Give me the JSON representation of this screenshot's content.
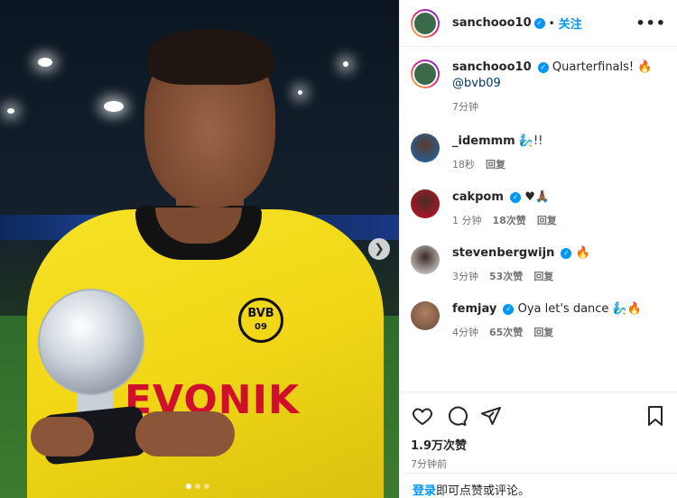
{
  "photo": {
    "sponsor_text": "EVONIK",
    "badge_text": "BVB",
    "badge_sub": "09"
  },
  "header": {
    "username": "sanchooo10",
    "separator": "•",
    "follow_label": "关注",
    "more_label": "•••"
  },
  "caption": {
    "username": "sanchooo10",
    "text": "Quarterfinals! 🔥",
    "mention": "@bvb09",
    "time": "7分钟"
  },
  "comments": [
    {
      "username": "_idemmm",
      "verified": false,
      "text": "🧞‍♂️!!",
      "time": "18秒",
      "likes": "",
      "reply": "回复"
    },
    {
      "username": "cakpom",
      "verified": true,
      "text": "♥🙏🏾",
      "time": "1 分钟",
      "likes": "18次赞",
      "reply": "回复"
    },
    {
      "username": "stevenbergwijn",
      "verified": true,
      "text": "🔥",
      "time": "3分钟",
      "likes": "53次赞",
      "reply": "回复"
    },
    {
      "username": "femjay",
      "verified": true,
      "text": "Oya let's dance 🧞‍♂️🔥",
      "time": "4分钟",
      "likes": "65次赞",
      "reply": "回复"
    }
  ],
  "footer": {
    "likes": "1.9万次赞",
    "time": "7分钟前",
    "login_link": "登录",
    "login_rest": "即可点赞或评论。"
  },
  "colors": {
    "accent": "#0095f6",
    "jersey": "#f1d716",
    "sponsor": "#d0102a"
  }
}
